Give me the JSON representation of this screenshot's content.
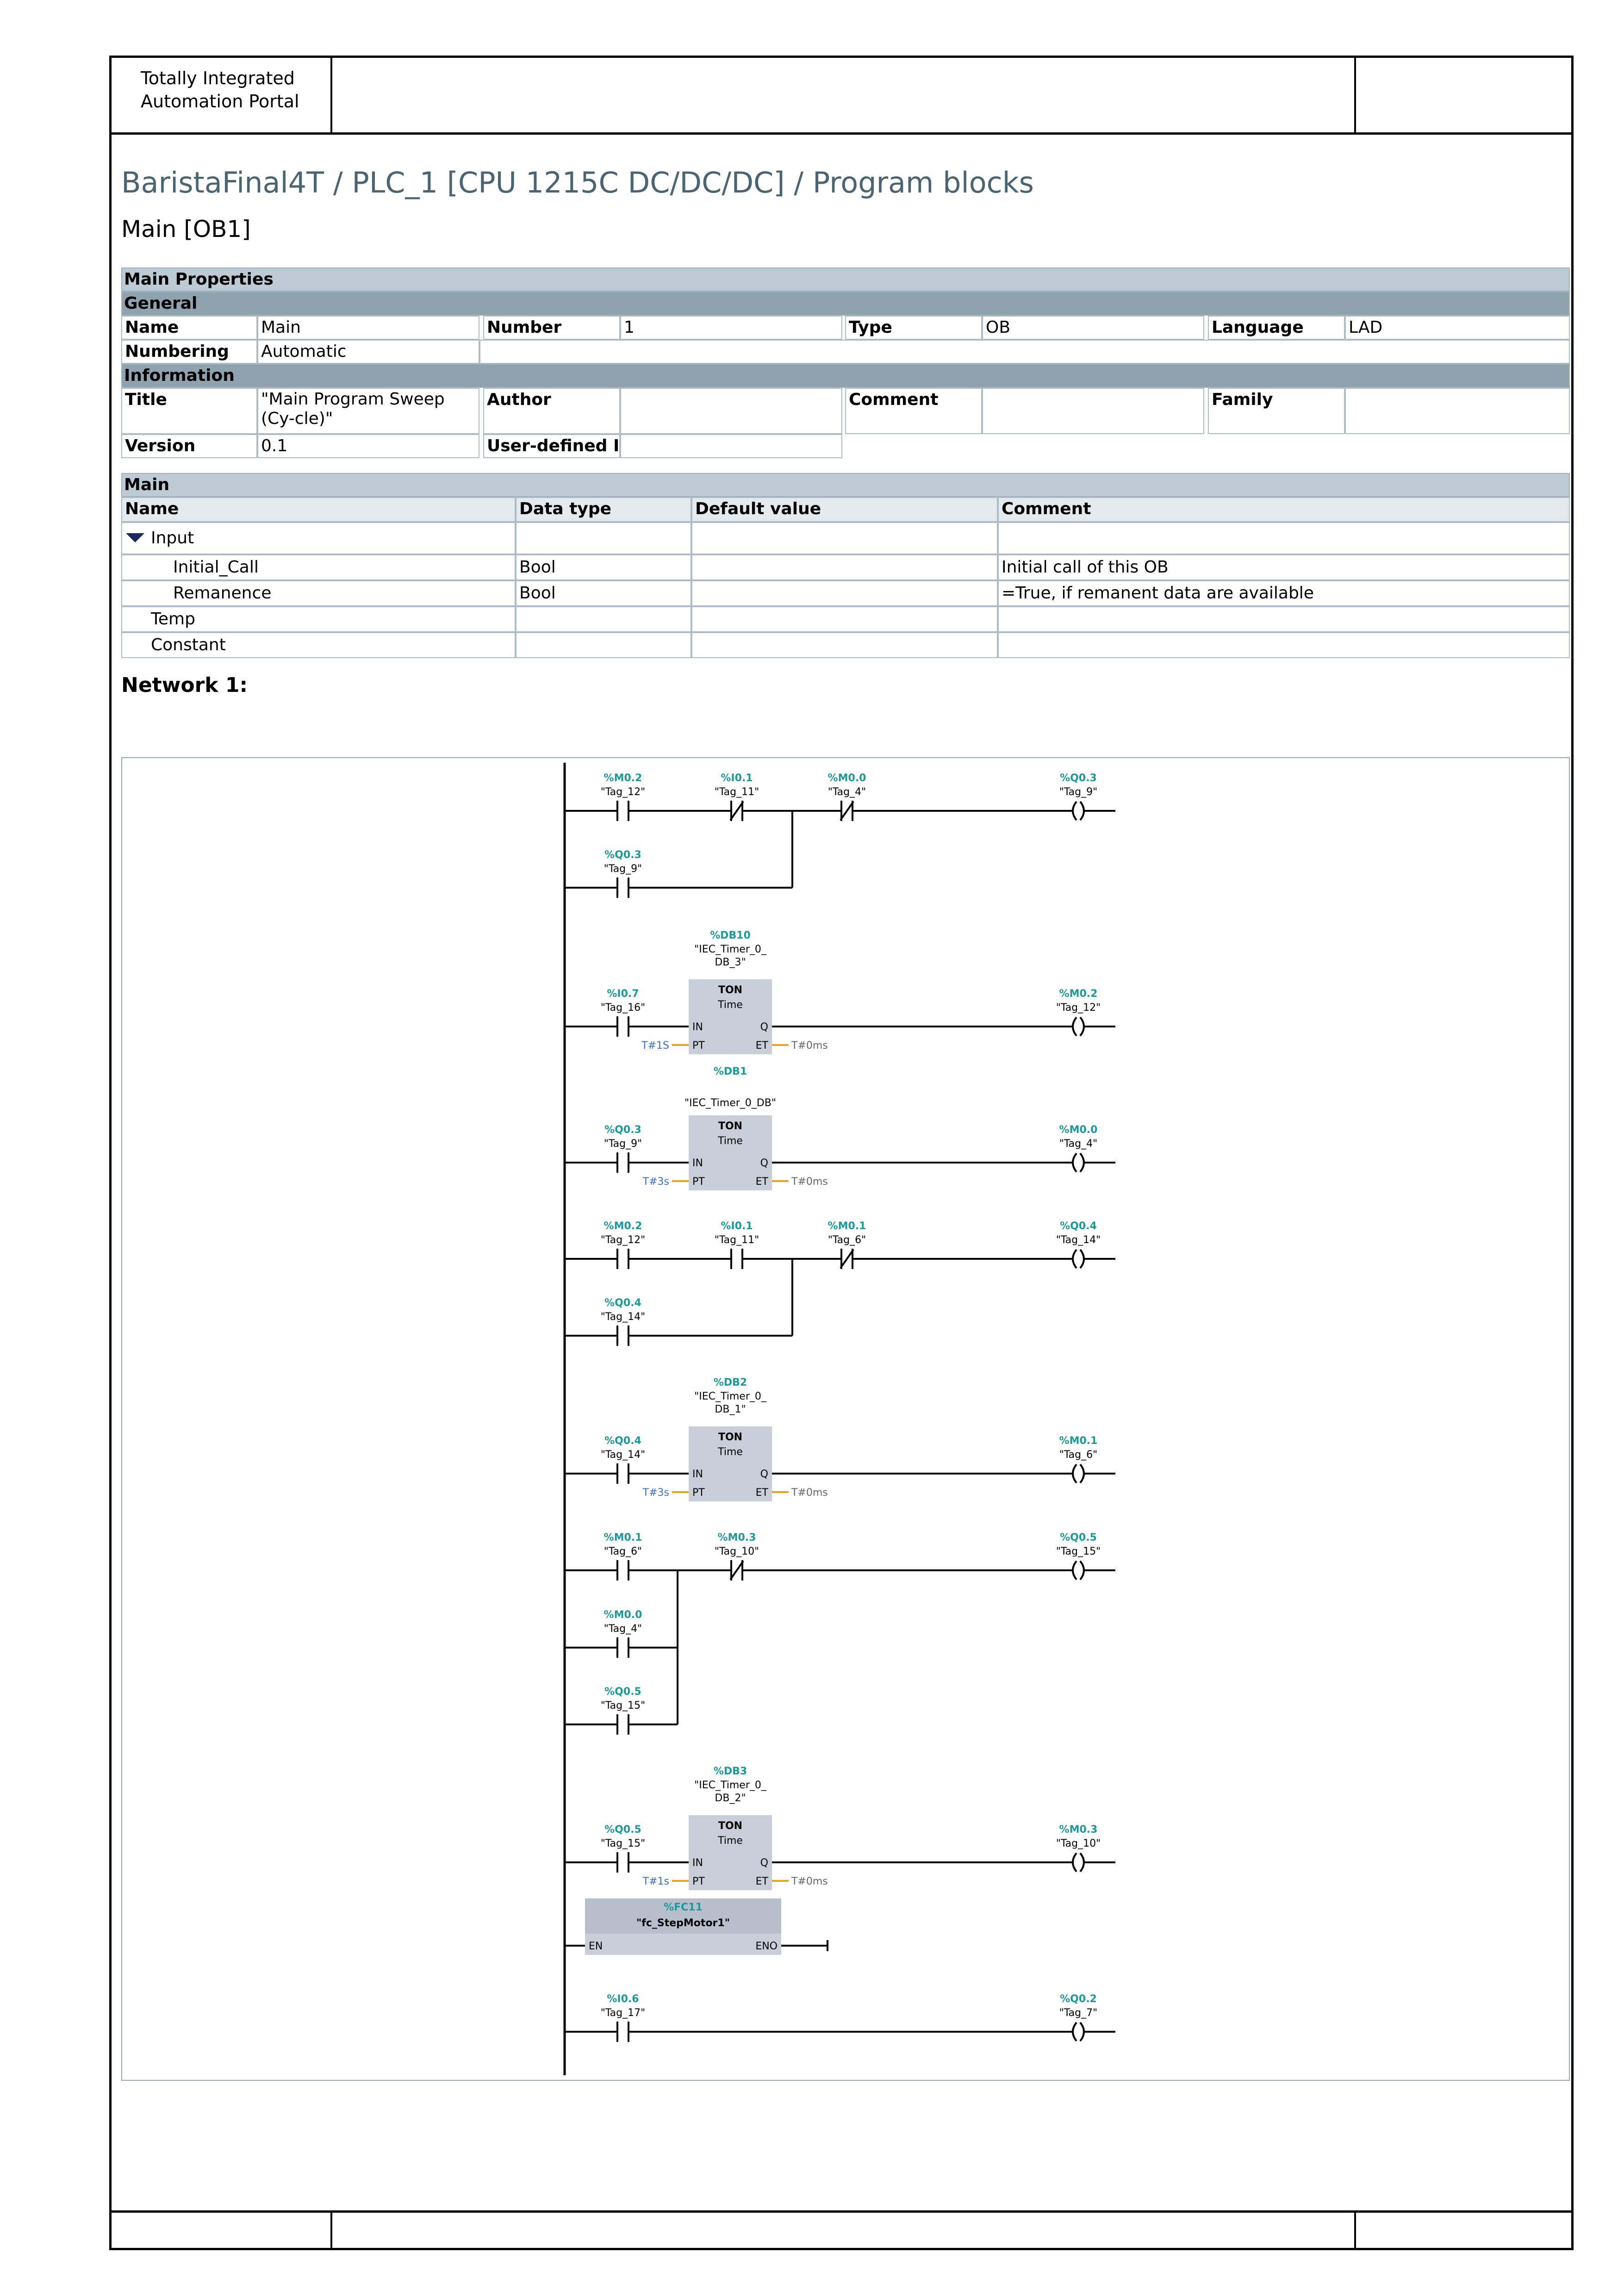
{
  "header": {
    "portal_title": "Totally Integrated\nAutomation Portal"
  },
  "breadcrumb": "BaristaFinal4T / PLC_1 [CPU 1215C DC/DC/DC] / Program blocks",
  "block_title": "Main [OB1]",
  "properties": {
    "section": "Main Properties",
    "general": "General",
    "name_label": "Name",
    "name_value": "Main",
    "number_label": "Number",
    "number_value": "1",
    "type_label": "Type",
    "type_value": "OB",
    "language_label": "Language",
    "language_value": "LAD",
    "numbering_label": "Numbering",
    "numbering_value": "Automatic",
    "information": "Information",
    "title_label": "Title",
    "title_value": "\"Main Program Sweep (Cy-cle)\"",
    "author_label": "Author",
    "author_value": "",
    "comment_label": "Comment",
    "comment_value": "",
    "family_label": "Family",
    "family_value": "",
    "version_label": "Version",
    "version_value": "0.1",
    "userid_label": "User-defined ID",
    "userid_value": ""
  },
  "interface": {
    "section": "Main",
    "columns": [
      "Name",
      "Data type",
      "Default value",
      "Comment"
    ],
    "rows": [
      {
        "name": "Input",
        "type": "",
        "default": "",
        "comment": ""
      },
      {
        "name": "Initial_Call",
        "type": "Bool",
        "default": "",
        "comment": "Initial call of this OB"
      },
      {
        "name": "Remanence",
        "type": "Bool",
        "default": "",
        "comment": "=True, if remanent data are available"
      },
      {
        "name": "Temp",
        "type": "",
        "default": "",
        "comment": ""
      },
      {
        "name": "Constant",
        "type": "",
        "default": "",
        "comment": ""
      }
    ]
  },
  "network_title": "Network 1:",
  "colors": {
    "address": "#1a9a9a",
    "constant": "#3a6fd0",
    "wire_param": "#f0a020",
    "box": "#c9ced8"
  },
  "ladder": {
    "rungs": [
      {
        "contacts": [
          {
            "addr": "%M0.2",
            "tag": "\"Tag_12\"",
            "type": "NO"
          },
          {
            "addr": "%I0.1",
            "tag": "\"Tag_11\"",
            "type": "NC"
          },
          {
            "addr": "%M0.0",
            "tag": "\"Tag_4\"",
            "type": "NC"
          }
        ],
        "branches": [
          {
            "addr": "%Q0.3",
            "tag": "\"Tag_9\"",
            "type": "NO"
          }
        ],
        "coil": {
          "addr": "%Q0.3",
          "tag": "\"Tag_9\""
        }
      },
      {
        "timer": {
          "db": "%DB10",
          "name": "\"IEC_Timer_0_\nDB_3\"",
          "type": "TON",
          "sub": "Time",
          "pt": "T#1S",
          "et": "T#0ms",
          "in": "IN",
          "q": "Q",
          "ptpin": "PT",
          "etpin": "ET"
        },
        "contacts": [
          {
            "addr": "%I0.7",
            "tag": "\"Tag_16\"",
            "type": "NO"
          }
        ],
        "coil": {
          "addr": "%M0.2",
          "tag": "\"Tag_12\""
        }
      },
      {
        "timer": {
          "db": "%DB1",
          "name": "\"IEC_Timer_0_DB\"",
          "type": "TON",
          "sub": "Time",
          "pt": "T#3s",
          "et": "T#0ms",
          "in": "IN",
          "q": "Q",
          "ptpin": "PT",
          "etpin": "ET"
        },
        "contacts": [
          {
            "addr": "%Q0.3",
            "tag": "\"Tag_9\"",
            "type": "NO"
          }
        ],
        "coil": {
          "addr": "%M0.0",
          "tag": "\"Tag_4\""
        }
      },
      {
        "contacts": [
          {
            "addr": "%M0.2",
            "tag": "\"Tag_12\"",
            "type": "NO"
          },
          {
            "addr": "%I0.1",
            "tag": "\"Tag_11\"",
            "type": "NO"
          },
          {
            "addr": "%M0.1",
            "tag": "\"Tag_6\"",
            "type": "NC"
          }
        ],
        "branches": [
          {
            "addr": "%Q0.4",
            "tag": "\"Tag_14\"",
            "type": "NO"
          }
        ],
        "coil": {
          "addr": "%Q0.4",
          "tag": "\"Tag_14\""
        }
      },
      {
        "timer": {
          "db": "%DB2",
          "name": "\"IEC_Timer_0_\nDB_1\"",
          "type": "TON",
          "sub": "Time",
          "pt": "T#3s",
          "et": "T#0ms",
          "in": "IN",
          "q": "Q",
          "ptpin": "PT",
          "etpin": "ET"
        },
        "contacts": [
          {
            "addr": "%Q0.4",
            "tag": "\"Tag_14\"",
            "type": "NO"
          }
        ],
        "coil": {
          "addr": "%M0.1",
          "tag": "\"Tag_6\""
        }
      },
      {
        "contacts": [
          {
            "addr": "%M0.1",
            "tag": "\"Tag_6\"",
            "type": "NO"
          },
          {
            "addr": "%M0.3",
            "tag": "\"Tag_10\"",
            "type": "NC"
          }
        ],
        "branches": [
          {
            "addr": "%M0.0",
            "tag": "\"Tag_4\"",
            "type": "NO"
          },
          {
            "addr": "%Q0.5",
            "tag": "\"Tag_15\"",
            "type": "NO"
          }
        ],
        "coil": {
          "addr": "%Q0.5",
          "tag": "\"Tag_15\""
        }
      },
      {
        "timer": {
          "db": "%DB3",
          "name": "\"IEC_Timer_0_\nDB_2\"",
          "type": "TON",
          "sub": "Time",
          "pt": "T#1s",
          "et": "T#0ms",
          "in": "IN",
          "q": "Q",
          "ptpin": "PT",
          "etpin": "ET"
        },
        "contacts": [
          {
            "addr": "%Q0.5",
            "tag": "\"Tag_15\"",
            "type": "NO"
          }
        ],
        "coil": {
          "addr": "%M0.3",
          "tag": "\"Tag_10\""
        }
      },
      {
        "fc": {
          "addr": "%FC11",
          "name": "\"fc_StepMotor1\"",
          "en": "EN",
          "eno": "ENO"
        }
      },
      {
        "contacts": [
          {
            "addr": "%I0.6",
            "tag": "\"Tag_17\"",
            "type": "NO"
          }
        ],
        "coil": {
          "addr": "%Q0.2",
          "tag": "\"Tag_7\""
        }
      }
    ]
  }
}
